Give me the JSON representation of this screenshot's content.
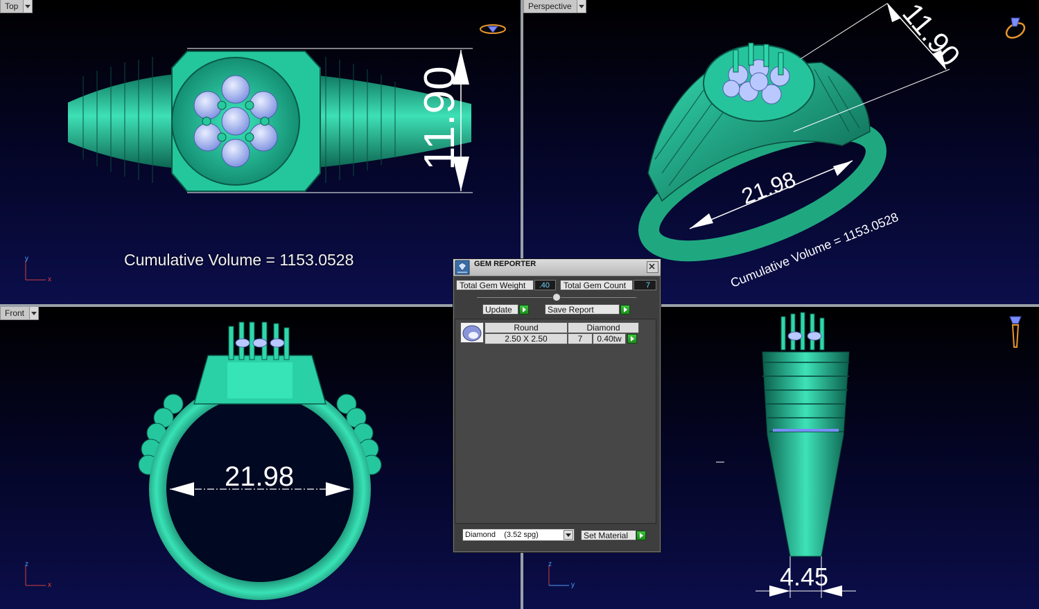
{
  "viewports": {
    "top": {
      "label": "Top",
      "dimension": "11.90",
      "volume_text": "Cumulative Volume = 1153.0528",
      "axis_vertical": "y",
      "axis_horizontal": "x"
    },
    "perspective": {
      "label": "Perspective",
      "dimension_height": "11.90",
      "dimension_width": "21.98",
      "volume_text": "Cumulative Volume = 1153.0528"
    },
    "front": {
      "label": "Front",
      "dimension": "21.98",
      "axis_vertical": "z",
      "axis_horizontal": "x"
    },
    "side": {
      "dimension": "4.45",
      "axis_vertical": "z",
      "axis_horizontal": "y"
    }
  },
  "gem_reporter": {
    "title": "GEM REPORTER",
    "total_weight_label": "Total Gem Weight",
    "total_weight_value": ".40",
    "total_count_label": "Total Gem Count",
    "total_count_value": "7",
    "update_label": "Update",
    "save_report_label": "Save Report",
    "gem_row": {
      "shape": "Round",
      "size": "2.50 X 2.50",
      "material": "Diamond",
      "count": "7",
      "weight": "0.40tw"
    },
    "material_select": "Diamond    (3.52 spg)",
    "set_material_label": "Set Material"
  },
  "colors": {
    "metal": "#2fd3a6",
    "gem": "#b8c8ff",
    "background_top": "#000000",
    "background_bottom": "#0b0e4a",
    "accent_go": "#2aa52a"
  }
}
